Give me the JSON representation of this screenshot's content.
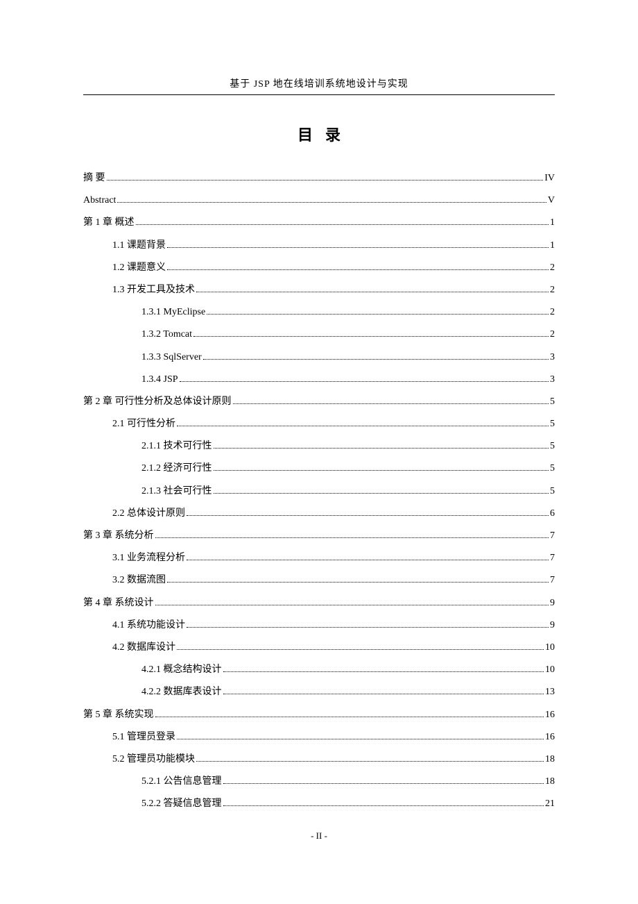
{
  "header": {
    "title": "基于 JSP 地在线培训系统地设计与实现"
  },
  "toc_title": "目录",
  "entries": [
    {
      "label": "摘    要",
      "page": "IV",
      "indent": 0
    },
    {
      "label": "Abstract",
      "page": "V",
      "indent": 0
    },
    {
      "label": "第 1 章  概述",
      "page": "1",
      "indent": 0
    },
    {
      "label": "1.1  课题背景",
      "page": "1",
      "indent": 1
    },
    {
      "label": "1.2  课题意义",
      "page": "2",
      "indent": 1
    },
    {
      "label": "1.3 开发工具及技术",
      "page": "2",
      "indent": 1
    },
    {
      "label": "1.3.1 MyEclipse",
      "page": "2",
      "indent": 2
    },
    {
      "label": "1.3.2 Tomcat",
      "page": "2",
      "indent": 2
    },
    {
      "label": "1.3.3 SqlServer",
      "page": "3",
      "indent": 2
    },
    {
      "label": "1.3.4 JSP",
      "page": "3",
      "indent": 2
    },
    {
      "label": "第 2 章 可行性分析及总体设计原则",
      "page": "5",
      "indent": 0
    },
    {
      "label": "2.1 可行性分析",
      "page": "5",
      "indent": 1
    },
    {
      "label": "2.1.1 技术可行性",
      "page": "5",
      "indent": 2
    },
    {
      "label": "2.1.2 经济可行性",
      "page": "5",
      "indent": 2
    },
    {
      "label": "2.1.3 社会可行性",
      "page": "5",
      "indent": 2
    },
    {
      "label": "2.2 总体设计原则",
      "page": "6",
      "indent": 1
    },
    {
      "label": "第 3 章  系统分析",
      "page": "7",
      "indent": 0
    },
    {
      "label": "3.1 业务流程分析",
      "page": "7",
      "indent": 1
    },
    {
      "label": "3.2 数据流图",
      "page": "7",
      "indent": 1
    },
    {
      "label": "第 4 章  系统设计",
      "page": "9",
      "indent": 0
    },
    {
      "label": "4.1 系统功能设计",
      "page": "9",
      "indent": 1
    },
    {
      "label": "4.2 数据库设计",
      "page": "10",
      "indent": 1
    },
    {
      "label": "4.2.1 概念结构设计",
      "page": "10",
      "indent": 2
    },
    {
      "label": "4.2.2 数据库表设计",
      "page": "13",
      "indent": 2
    },
    {
      "label": "第 5 章  系统实现",
      "page": "16",
      "indent": 0
    },
    {
      "label": "5.1 管理员登录",
      "page": "16",
      "indent": 1
    },
    {
      "label": "5.2 管理员功能模块",
      "page": "18",
      "indent": 1
    },
    {
      "label": "5.2.1 公告信息管理",
      "page": "18",
      "indent": 2
    },
    {
      "label": "5.2.2 答疑信息管理",
      "page": "21",
      "indent": 2
    }
  ],
  "footer": {
    "page_number": "- II -"
  }
}
